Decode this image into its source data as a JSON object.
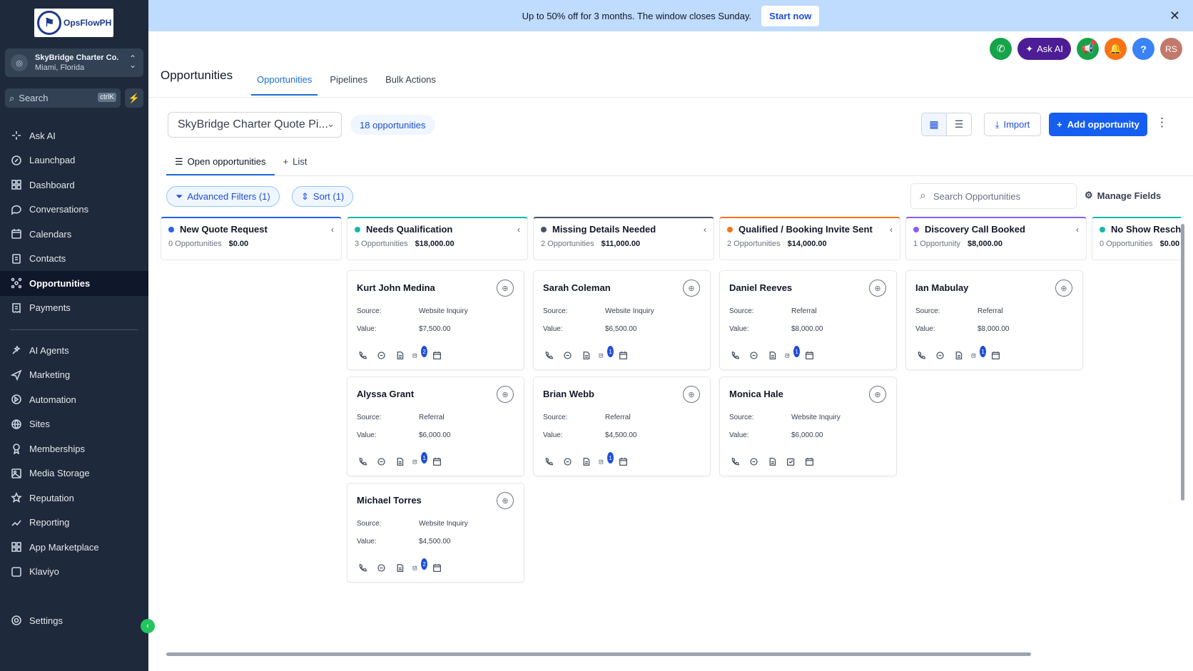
{
  "brand": {
    "name": "OpsFlowPH"
  },
  "account": {
    "name": "SkyBridge Charter Co.",
    "location": "Miami, Florida"
  },
  "search": {
    "placeholder": "Search",
    "shortcut": "ctrlK"
  },
  "nav_primary": [
    {
      "label": "Ask AI",
      "icon": "sparkle-icon"
    },
    {
      "label": "Launchpad",
      "icon": "rocket-icon"
    },
    {
      "label": "Dashboard",
      "icon": "grid-icon"
    },
    {
      "label": "Conversations",
      "icon": "chat-icon"
    },
    {
      "label": "Calendars",
      "icon": "calendar-icon"
    },
    {
      "label": "Contacts",
      "icon": "contacts-icon"
    },
    {
      "label": "Opportunities",
      "icon": "opportunities-icon",
      "active": true
    },
    {
      "label": "Payments",
      "icon": "receipt-icon"
    }
  ],
  "nav_secondary": [
    {
      "label": "AI Agents",
      "icon": "ai-agent-icon"
    },
    {
      "label": "Marketing",
      "icon": "send-icon"
    },
    {
      "label": "Automation",
      "icon": "automation-icon"
    },
    {
      "label": "Sites",
      "icon": "globe-icon"
    },
    {
      "label": "Memberships",
      "icon": "award-icon"
    },
    {
      "label": "Media Storage",
      "icon": "image-icon"
    },
    {
      "label": "Reputation",
      "icon": "star-icon"
    },
    {
      "label": "Reporting",
      "icon": "trend-icon"
    },
    {
      "label": "App Marketplace",
      "icon": "apps-icon"
    },
    {
      "label": "Klaviyo",
      "icon": "klaviyo-icon"
    }
  ],
  "settings": {
    "label": "Settings"
  },
  "banner": {
    "text": "Up to 50% off for 3 months. The window closes Sunday.",
    "cta": "Start now"
  },
  "topbar": {
    "ask_ai": "Ask AI",
    "avatar_initials": "RS"
  },
  "page": {
    "title": "Opportunities"
  },
  "tabs": [
    {
      "label": "Opportunities",
      "active": true
    },
    {
      "label": "Pipelines"
    },
    {
      "label": "Bulk Actions"
    }
  ],
  "toolbar": {
    "pipeline": "SkyBridge Charter Quote Pi...",
    "count": "18 opportunities",
    "import": "Import",
    "add": "Add opportunity"
  },
  "subtabs": [
    {
      "label": "Open opportunities",
      "active": true
    },
    {
      "label": "List"
    }
  ],
  "filters": {
    "advanced": "Advanced Filters (1)",
    "sort": "Sort (1)",
    "search_placeholder": "Search Opportunities",
    "manage": "Manage Fields"
  },
  "labels": {
    "source": "Source:",
    "value": "Value:"
  },
  "colors": {
    "accent": "#155eef",
    "sidebar": "#1e293b"
  },
  "columns": [
    {
      "title": "New Quote Request",
      "count": "0 Opportunities",
      "total": "$0.00",
      "dot": "#2563eb",
      "cards": []
    },
    {
      "title": "Needs Qualification",
      "count": "3 Opportunities",
      "total": "$18,000.00",
      "dot": "#14b8a6",
      "cards": [
        {
          "name": "Kurt John Medina",
          "source": "Website Inquiry",
          "value": "$7,500.00",
          "badge": "2"
        },
        {
          "name": "Alyssa Grant",
          "source": "Referral",
          "value": "$6,000.00",
          "badge": "1"
        },
        {
          "name": "Michael Torres",
          "source": "Website Inquiry",
          "value": "$4,500.00",
          "badge": "2"
        }
      ]
    },
    {
      "title": "Missing Details Needed",
      "count": "2 Opportunities",
      "total": "$11,000.00",
      "dot": "#475569",
      "cards": [
        {
          "name": "Sarah Coleman",
          "source": "Website Inquiry",
          "value": "$6,500.00",
          "badge": "1"
        },
        {
          "name": "Brian Webb",
          "source": "Referral",
          "value": "$4,500.00",
          "badge": "1"
        }
      ]
    },
    {
      "title": "Qualified / Booking Invite Sent",
      "count": "2 Opportunities",
      "total": "$14,000.00",
      "dot": "#f97316",
      "cards": [
        {
          "name": "Daniel Reeves",
          "source": "Referral",
          "value": "$8,000.00",
          "badge": "1"
        },
        {
          "name": "Monica Hale",
          "source": "Website Inquiry",
          "value": "$6,000.00",
          "badge": ""
        }
      ]
    },
    {
      "title": "Discovery Call Booked",
      "count": "1 Opportunity",
      "total": "$8,000.00",
      "dot": "#8b5cf6",
      "cards": [
        {
          "name": "Ian Mabulay",
          "source": "Referral",
          "value": "$8,000.00",
          "badge": "1"
        }
      ]
    },
    {
      "title": "No Show Reschedule Nee...",
      "count": "0 Opportunities",
      "total": "$0.00",
      "dot": "#14b8a6",
      "cards": []
    }
  ]
}
